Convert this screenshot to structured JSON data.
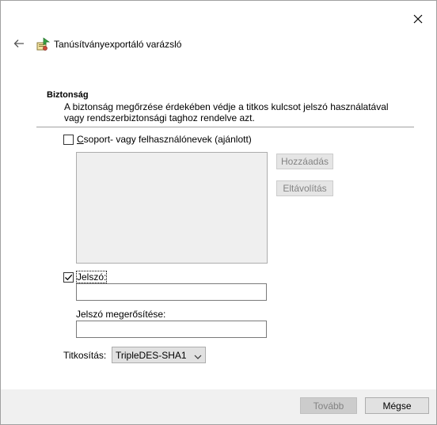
{
  "window": {
    "title": "Tanúsítványexportáló varázsló"
  },
  "section": {
    "title": "Biztonság",
    "description": "A biztonság megőrzése érdekében védje a titkos kulcsot jelszó használatával vagy rendszerbiztonsági taghoz rendelve azt."
  },
  "groups_option": {
    "checked": false,
    "label_access_key": "C",
    "label_rest": "soport- vagy felhasználónevek (ajánlott)"
  },
  "buttons": {
    "add_label": "Hozzáadás",
    "remove_label": "Eltávolítás",
    "next_label": "Tovább",
    "cancel_label": "Mégse"
  },
  "password_option": {
    "checked": true,
    "label": "Jelszó:",
    "value": ""
  },
  "confirm": {
    "label": "Jelszó megerősítése:",
    "value": ""
  },
  "encryption": {
    "label": "Titkosítás:",
    "selected": "TripleDES-SHA1"
  },
  "icons": {
    "close": "close-icon",
    "back": "back-arrow-icon",
    "wizard": "certificate-export-icon",
    "dropdown": "chevron-down-icon"
  },
  "colors": {
    "footer_bg": "#f0f0f0",
    "disabled_text": "#838383",
    "divider": "#a0a0a0"
  }
}
